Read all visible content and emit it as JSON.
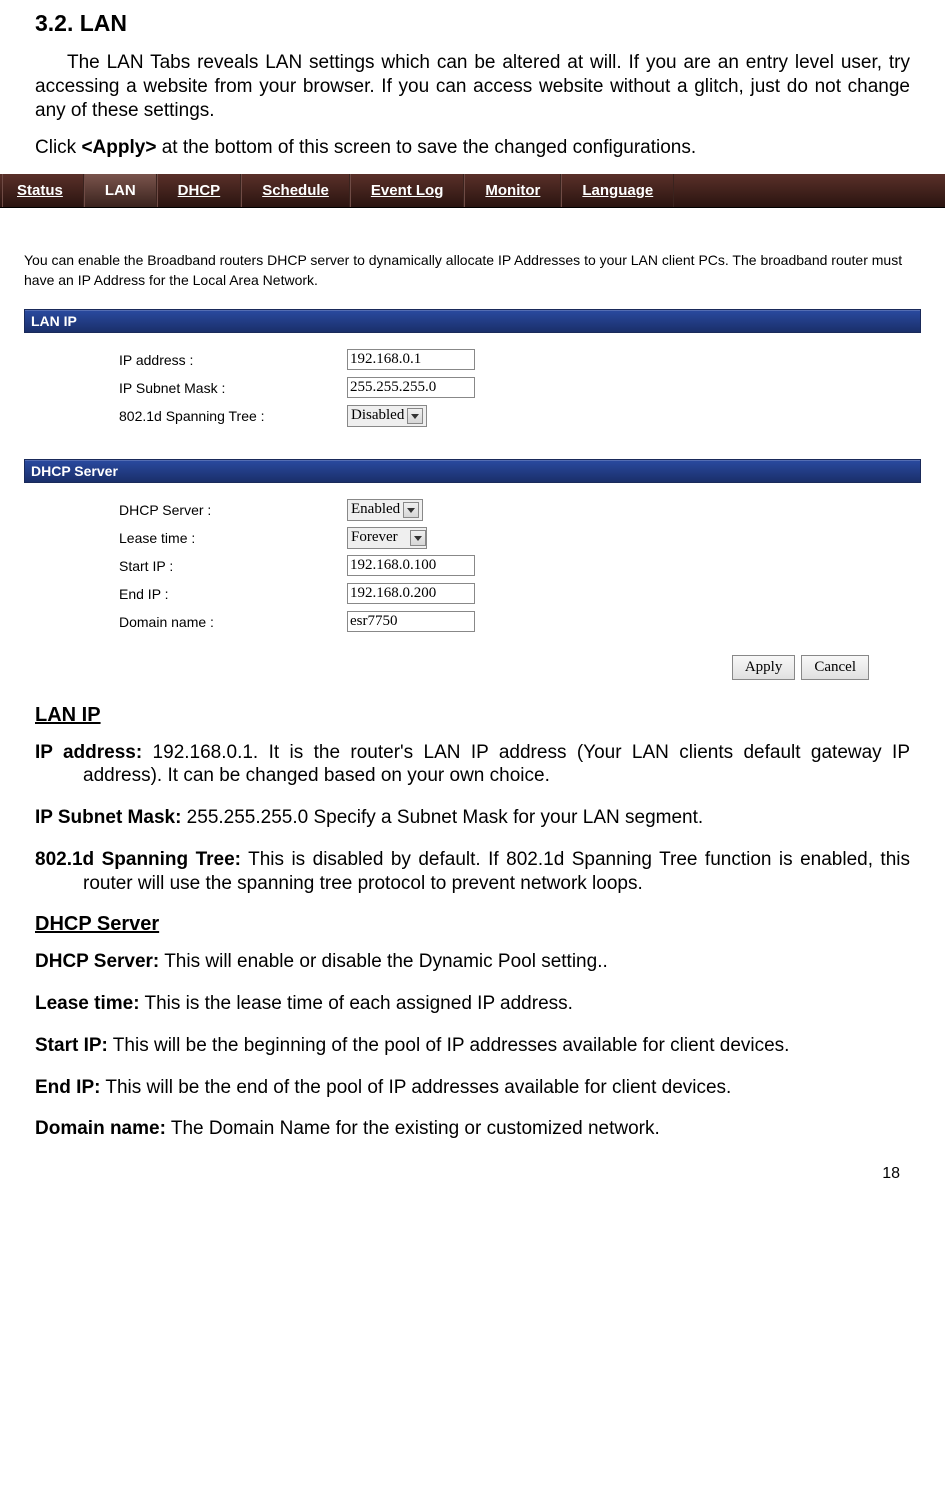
{
  "heading": "3.2. LAN",
  "para1": "The LAN Tabs reveals LAN settings which can be altered at will. If you are an entry level user, try accessing a website from your browser. If you can access website without a glitch, just do not change any of these settings.",
  "para2_pre": "Click ",
  "para2_bold": "<Apply>",
  "para2_post": " at the bottom of this screen to save the changed configurations.",
  "tabs": {
    "status": "Status",
    "lan": "LAN",
    "dhcp": "DHCP",
    "schedule": "Schedule",
    "eventlog": "Event Log",
    "monitor": "Monitor",
    "language": "Language"
  },
  "intro": "You can enable the Broadband routers DHCP server to dynamically allocate IP Addresses to your LAN client PCs. The broadband router must have an IP Address for the Local Area Network.",
  "lanip": {
    "header": "LAN IP",
    "rows": {
      "ip_label": "IP address :",
      "ip_value": "192.168.0.1",
      "mask_label": "IP Subnet Mask :",
      "mask_value": "255.255.255.0",
      "spanning_label": "802.1d Spanning Tree :",
      "spanning_value": "Disabled"
    }
  },
  "dhcp": {
    "header": "DHCP Server",
    "rows": {
      "server_label": "DHCP Server :",
      "server_value": "Enabled",
      "lease_label": "Lease time :",
      "lease_value": "Forever",
      "start_label": "Start IP :",
      "start_value": "192.168.0.100",
      "end_label": "End IP :",
      "end_value": "192.168.0.200",
      "domain_label": "Domain name :",
      "domain_value": "esr7750"
    }
  },
  "buttons": {
    "apply": "Apply",
    "cancel": "Cancel"
  },
  "sections": {
    "lanip_heading": "LAN IP",
    "ip_term": "IP address:",
    "ip_desc": " 192.168.0.1. It is the router's LAN IP address (Your LAN clients default gateway IP address). It can be changed based on your own choice.",
    "mask_term": "IP Subnet Mask:",
    "mask_desc": " 255.255.255.0 Specify a Subnet Mask for your LAN segment.",
    "span_term": "802.1d Spanning Tree:",
    "span_desc": " This is disabled by default. If 802.1d Spanning Tree function is enabled, this router will use the spanning tree protocol to prevent network loops.",
    "dhcp_heading": "DHCP Server",
    "dhcpserver_term": "DHCP Server:",
    "dhcpserver_desc": " This will enable or disable the Dynamic Pool setting..",
    "lease_term": "Lease time:",
    "lease_desc": " This is the lease time of each assigned IP address.",
    "start_term": "Start IP:",
    "start_desc": " This will be the beginning of the pool of IP addresses available for client devices.",
    "end_term": "End IP:",
    "end_desc": " This will be the end of the pool of IP addresses available for client devices.",
    "domain_term": "Domain name:",
    "domain_desc": " The Domain Name for the existing or customized network."
  },
  "page_number": "18"
}
